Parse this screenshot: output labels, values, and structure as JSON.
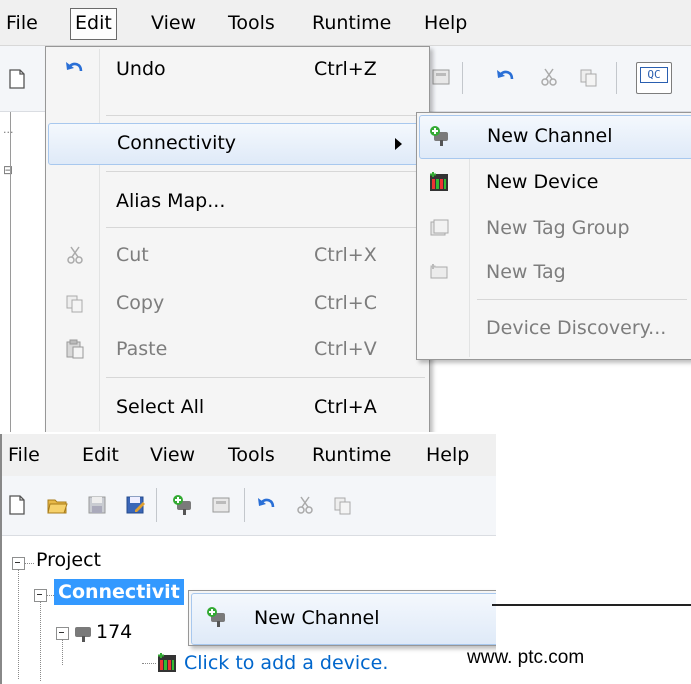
{
  "top": {
    "menubar": [
      "File",
      "Edit",
      "View",
      "Tools",
      "Runtime",
      "Help"
    ],
    "edit_menu": {
      "undo": {
        "label": "Undo",
        "shortcut": "Ctrl+Z"
      },
      "connectivity": {
        "label": "Connectivity"
      },
      "alias_map": {
        "label": "Alias Map..."
      },
      "cut": {
        "label": "Cut",
        "shortcut": "Ctrl+X"
      },
      "copy": {
        "label": "Copy",
        "shortcut": "Ctrl+C"
      },
      "paste": {
        "label": "Paste",
        "shortcut": "Ctrl+V"
      },
      "select_all": {
        "label": "Select All",
        "shortcut": "Ctrl+A"
      }
    },
    "connectivity_submenu": {
      "new_channel": "New Channel",
      "new_device": "New Device",
      "new_tag_group": "New Tag Group",
      "new_tag": "New Tag",
      "device_discovery": "Device Discovery..."
    },
    "toolbar_badge": "QC"
  },
  "bottom": {
    "menubar": [
      "File",
      "Edit",
      "View",
      "Tools",
      "Runtime",
      "Help"
    ],
    "tree": {
      "project": "Project",
      "connectivity": "Connectivit",
      "channel": "174",
      "add_device": "Click to add a device."
    },
    "context_menu": {
      "new_channel": "New Channel"
    }
  },
  "watermark": "www. ptc.com",
  "colors": {
    "selection": "#3399ff",
    "link": "#0066cc",
    "menu_highlight": "#dfeaf8",
    "disabled_text": "#7d7d7d"
  },
  "icons": [
    "new-document-icon",
    "undo-icon",
    "cut-icon",
    "copy-icon",
    "paste-icon",
    "new-channel-icon",
    "new-device-icon",
    "new-tag-group-icon",
    "new-tag-icon",
    "open-folder-icon",
    "save-icon",
    "save-as-icon",
    "properties-icon",
    "quick-client-icon"
  ]
}
